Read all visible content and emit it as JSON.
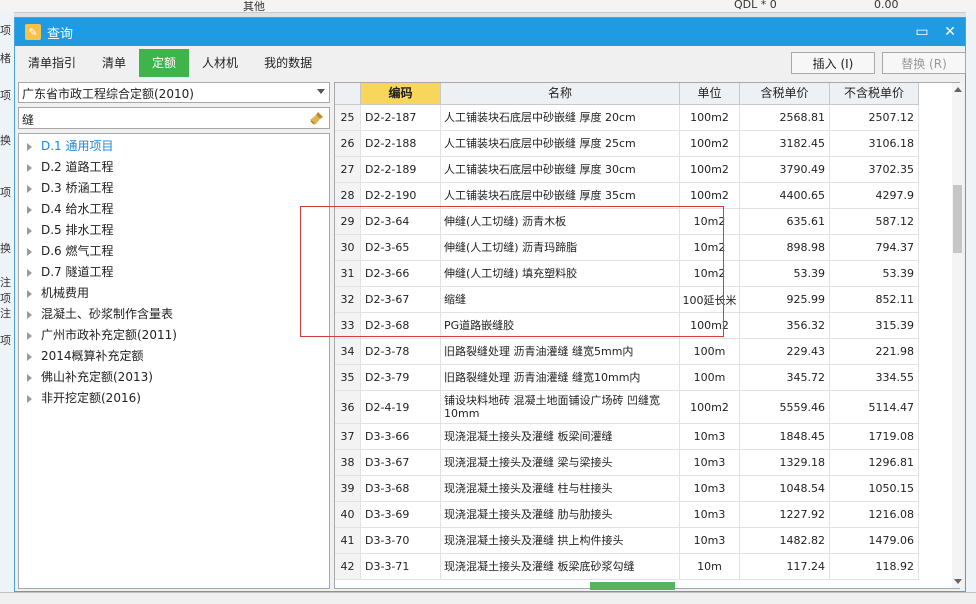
{
  "background": {
    "top_left_text": "其他",
    "top_right_text1": "QDL * 0",
    "top_right_text2": "0.00",
    "left_chars": [
      "项",
      "楮",
      "项",
      "换",
      "项",
      "换",
      "注",
      "项",
      "注",
      "项"
    ]
  },
  "dialog": {
    "title": "查询",
    "minimize_icon": "minimize-icon",
    "close_icon": "close-icon"
  },
  "tabs": [
    {
      "label": "清单指引",
      "active": false
    },
    {
      "label": "清单",
      "active": false
    },
    {
      "label": "定额",
      "active": true
    },
    {
      "label": "人材机",
      "active": false
    },
    {
      "label": "我的数据",
      "active": false
    }
  ],
  "buttons": {
    "insert": "插入 (I)",
    "replace": "替换 (R)"
  },
  "left": {
    "quota_library": "广东省市政工程综合定额(2010)",
    "search_value": "缝",
    "tree": [
      {
        "label": "D.1 通用项目",
        "selected": true
      },
      {
        "label": "D.2 道路工程",
        "selected": false
      },
      {
        "label": "D.3 桥涵工程",
        "selected": false
      },
      {
        "label": "D.4 给水工程",
        "selected": false
      },
      {
        "label": "D.5 排水工程",
        "selected": false
      },
      {
        "label": "D.6 燃气工程",
        "selected": false
      },
      {
        "label": "D.7 隧道工程",
        "selected": false
      },
      {
        "label": "机械费用",
        "selected": false
      },
      {
        "label": "混凝土、砂浆制作含量表",
        "selected": false
      },
      {
        "label": "广州市政补充定额(2011)",
        "selected": false
      },
      {
        "label": "2014概算补充定额",
        "selected": false
      },
      {
        "label": "佛山补充定额(2013)",
        "selected": false
      },
      {
        "label": "非开挖定额(2016)",
        "selected": false
      }
    ]
  },
  "grid": {
    "headers": {
      "num": "",
      "code": "编码",
      "name": "名称",
      "unit": "单位",
      "tax_price": "含税单价",
      "notax_price": "不含税单价"
    },
    "rows": [
      {
        "num": "25",
        "code": "D2-2-187",
        "name": "人工铺装块石底层中砂嵌缝 厚度 20cm",
        "unit": "100m2",
        "tax": "2568.81",
        "notax": "2507.12"
      },
      {
        "num": "26",
        "code": "D2-2-188",
        "name": "人工铺装块石底层中砂嵌缝 厚度 25cm",
        "unit": "100m2",
        "tax": "3182.45",
        "notax": "3106.18"
      },
      {
        "num": "27",
        "code": "D2-2-189",
        "name": "人工铺装块石底层中砂嵌缝 厚度 30cm",
        "unit": "100m2",
        "tax": "3790.49",
        "notax": "3702.35"
      },
      {
        "num": "28",
        "code": "D2-2-190",
        "name": "人工铺装块石底层中砂嵌缝 厚度 35cm",
        "unit": "100m2",
        "tax": "4400.65",
        "notax": "4297.9"
      },
      {
        "num": "29",
        "code": "D2-3-64",
        "name": "伸缝(人工切缝) 沥青木板",
        "unit": "10m2",
        "tax": "635.61",
        "notax": "587.12"
      },
      {
        "num": "30",
        "code": "D2-3-65",
        "name": "伸缝(人工切缝) 沥青玛蹄脂",
        "unit": "10m2",
        "tax": "898.98",
        "notax": "794.37"
      },
      {
        "num": "31",
        "code": "D2-3-66",
        "name": "伸缝(人工切缝) 填充塑料胶",
        "unit": "10m2",
        "tax": "53.39",
        "notax": "53.39"
      },
      {
        "num": "32",
        "code": "D2-3-67",
        "name": "缩缝",
        "unit": "100延长米",
        "tax": "925.99",
        "notax": "852.11"
      },
      {
        "num": "33",
        "code": "D2-3-68",
        "name": "PG道路嵌缝胶",
        "unit": "100m2",
        "tax": "356.32",
        "notax": "315.39"
      },
      {
        "num": "34",
        "code": "D2-3-78",
        "name": "旧路裂缝处理 沥青油灌缝 缝宽5mm内",
        "unit": "100m",
        "tax": "229.43",
        "notax": "221.98"
      },
      {
        "num": "35",
        "code": "D2-3-79",
        "name": "旧路裂缝处理 沥青油灌缝 缝宽10mm内",
        "unit": "100m",
        "tax": "345.72",
        "notax": "334.55"
      },
      {
        "num": "36",
        "code": "D2-4-19",
        "name": "铺设块料地砖 混凝土地面铺设广场砖 凹缝宽10mm",
        "unit": "100m2",
        "tax": "5559.46",
        "notax": "5114.47"
      },
      {
        "num": "37",
        "code": "D3-3-66",
        "name": "现浇混凝土接头及灌缝 板梁间灌缝",
        "unit": "10m3",
        "tax": "1848.45",
        "notax": "1719.08"
      },
      {
        "num": "38",
        "code": "D3-3-67",
        "name": "现浇混凝土接头及灌缝 梁与梁接头",
        "unit": "10m3",
        "tax": "1329.18",
        "notax": "1296.81"
      },
      {
        "num": "39",
        "code": "D3-3-68",
        "name": "现浇混凝土接头及灌缝 柱与柱接头",
        "unit": "10m3",
        "tax": "1048.54",
        "notax": "1050.15"
      },
      {
        "num": "40",
        "code": "D3-3-69",
        "name": "现浇混凝土接头及灌缝 肋与肋接头",
        "unit": "10m3",
        "tax": "1227.92",
        "notax": "1216.08"
      },
      {
        "num": "41",
        "code": "D3-3-70",
        "name": "现浇混凝土接头及灌缝 拱上构件接头",
        "unit": "10m3",
        "tax": "1482.82",
        "notax": "1479.06"
      },
      {
        "num": "42",
        "code": "D3-3-71",
        "name": "现浇混凝土接头及灌缝 板梁底砂浆勾缝",
        "unit": "10m",
        "tax": "117.24",
        "notax": "118.92"
      }
    ]
  }
}
